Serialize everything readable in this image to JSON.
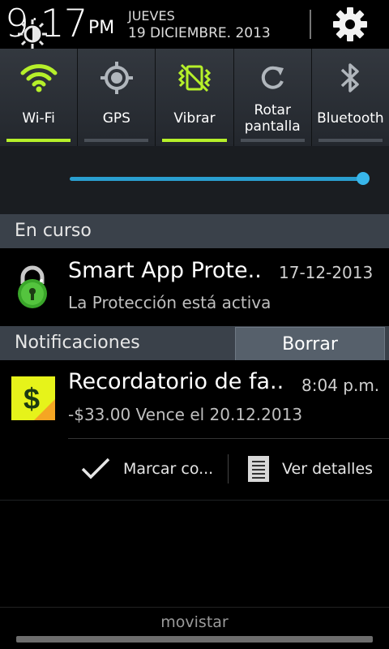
{
  "status": {
    "time": "9:17",
    "ampm": "PM",
    "day": "JUEVES",
    "date": "19 DICIEMBRE. 2013"
  },
  "toggles": [
    {
      "label": "Wi-Fi",
      "icon": "wifi-icon",
      "on": true
    },
    {
      "label": "GPS",
      "icon": "gps-icon",
      "on": false
    },
    {
      "label": "Vibrar",
      "icon": "vibrate-icon",
      "on": true
    },
    {
      "label_line1": "Rotar",
      "label_line2": "pantalla",
      "icon": "rotate-icon",
      "on": false
    },
    {
      "label": "Bluetooth",
      "icon": "bluetooth-icon",
      "on": false
    }
  ],
  "brightness": {
    "level": 1.0
  },
  "ongoing": {
    "header": "En curso",
    "item": {
      "title": "Smart App Prote..",
      "time": "17-12-2013",
      "subtitle": "La Protección está activa"
    }
  },
  "notifications": {
    "header": "Notificaciones",
    "clear_label": "Borrar",
    "item": {
      "title": "Recordatorio de fa..",
      "time": "8:04 p.m.",
      "subtitle": "-$33.00 Vence el 20.12.2013",
      "action_mark": "Marcar co...",
      "action_details": "Ver detalles"
    }
  },
  "carrier": "movistar",
  "colors": {
    "accent_green": "#b6f02a",
    "slider_blue": "#38b6ea",
    "section_bg": "#3a414a"
  }
}
